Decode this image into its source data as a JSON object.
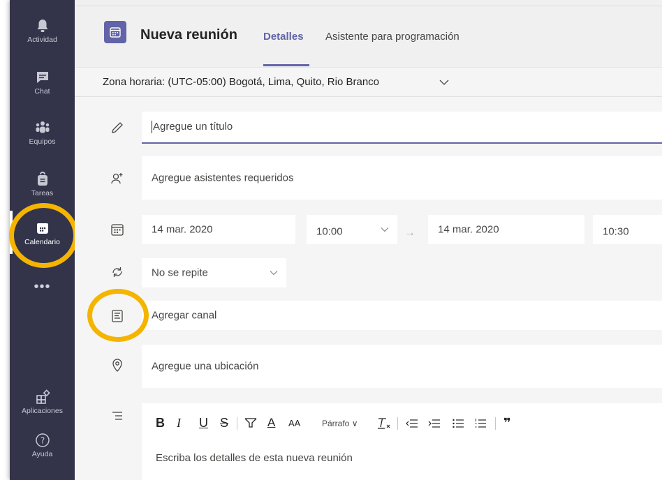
{
  "sidebar": {
    "items": [
      {
        "label": "Actividad",
        "icon": "bell-icon"
      },
      {
        "label": "Chat",
        "icon": "chat-icon"
      },
      {
        "label": "Equipos",
        "icon": "teams-icon"
      },
      {
        "label": "Tareas",
        "icon": "tasks-icon"
      },
      {
        "label": "Calendario",
        "icon": "calendar-icon",
        "active": true
      }
    ],
    "more": "•••",
    "bottom": [
      {
        "label": "Aplicaciones",
        "icon": "apps-icon"
      },
      {
        "label": "Ayuda",
        "icon": "help-icon"
      }
    ]
  },
  "header": {
    "title": "Nueva reunión",
    "tabs": [
      "Detalles",
      "Asistente para programación"
    ],
    "active_tab": "Detalles"
  },
  "timezone": {
    "label": "Zona horaria: (UTC-05:00) Bogotá, Lima, Quito, Rio Branco"
  },
  "form": {
    "title_placeholder": "Agregue un título",
    "attendees_placeholder": "Agregue asistentes requeridos",
    "start_date": "14 mar. 2020",
    "start_time": "10:00",
    "end_date": "14 mar. 2020",
    "end_time": "10:30",
    "repeat": "No se repite",
    "channel_placeholder": "Agregar canal",
    "location_placeholder": "Agregue una ubicación",
    "details_placeholder": "Escriba los detalles de esta nueva reunión"
  },
  "toolbar": {
    "bold": "B",
    "italic": "I",
    "underline": "U",
    "strike": "S",
    "font_size": "AA",
    "font_color": "A",
    "paragraph": "Párrafo",
    "quote": "❞"
  },
  "colors": {
    "accent": "#6264a7",
    "sidebar": "#33344a",
    "highlight": "#f5b400"
  }
}
